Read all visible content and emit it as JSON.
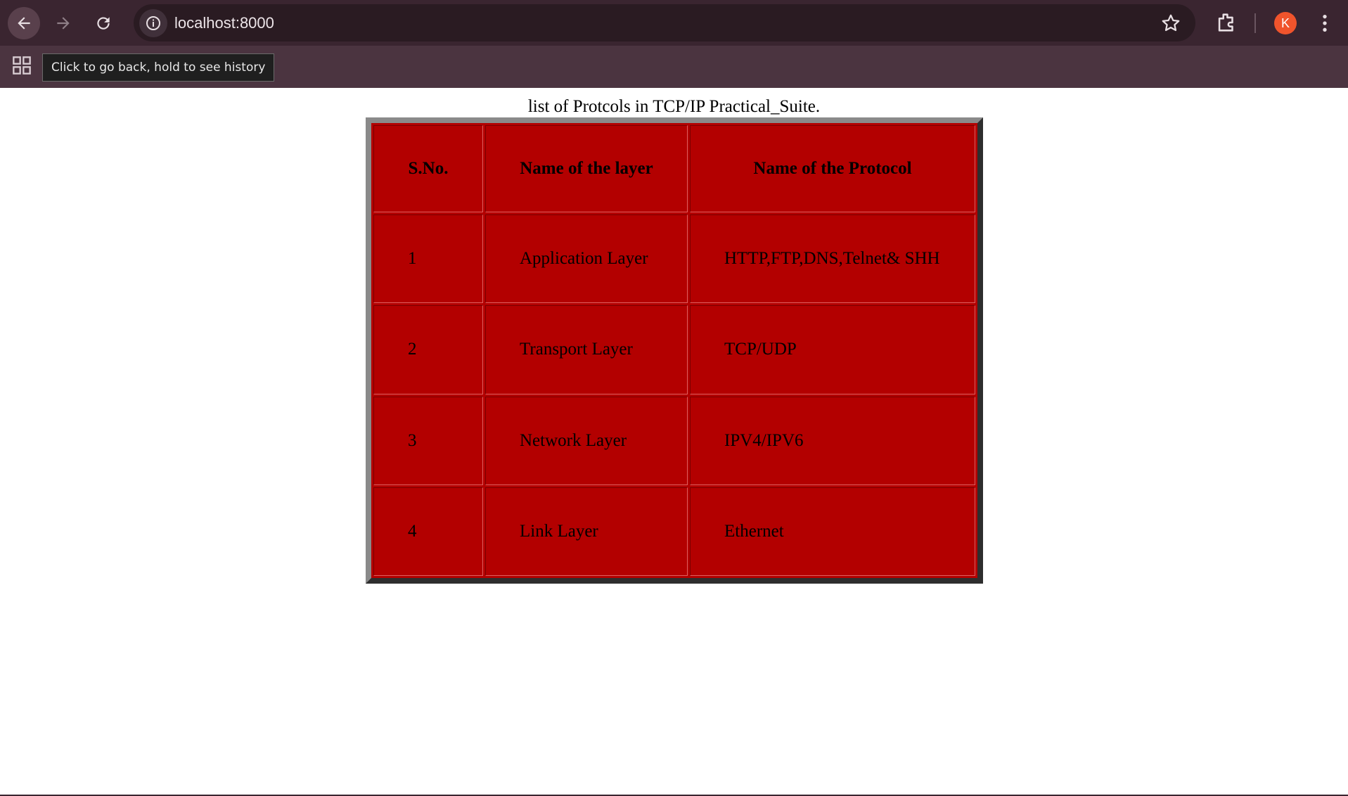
{
  "browser": {
    "url": "localhost:8000",
    "avatar_letter": "K",
    "tooltip": "Click to go back, hold to see history",
    "icons": [
      "back-arrow-icon",
      "forward-arrow-icon",
      "reload-icon",
      "site-info-icon",
      "star-icon",
      "extensions-icon",
      "kebab-menu-icon",
      "apps-grid-icon"
    ]
  },
  "page": {
    "caption": "list of Protcols in TCP/IP Practical_Suite.",
    "table": {
      "headers": [
        "S.No.",
        "Name of the layer",
        "Name of the Protocol"
      ],
      "rows": [
        [
          "1",
          "Application Layer",
          "HTTP,FTP,DNS,Telnet& SHH"
        ],
        [
          "2",
          "Transport Layer",
          "TCP/UDP"
        ],
        [
          "3",
          "Network Layer",
          "IPV4/IPV6"
        ],
        [
          "4",
          "Link Layer",
          "Ethernet"
        ]
      ]
    },
    "colors": {
      "cell_background": "#b30000",
      "chrome_toolbar": "#3a2530",
      "avatar": "#f0542c"
    }
  }
}
